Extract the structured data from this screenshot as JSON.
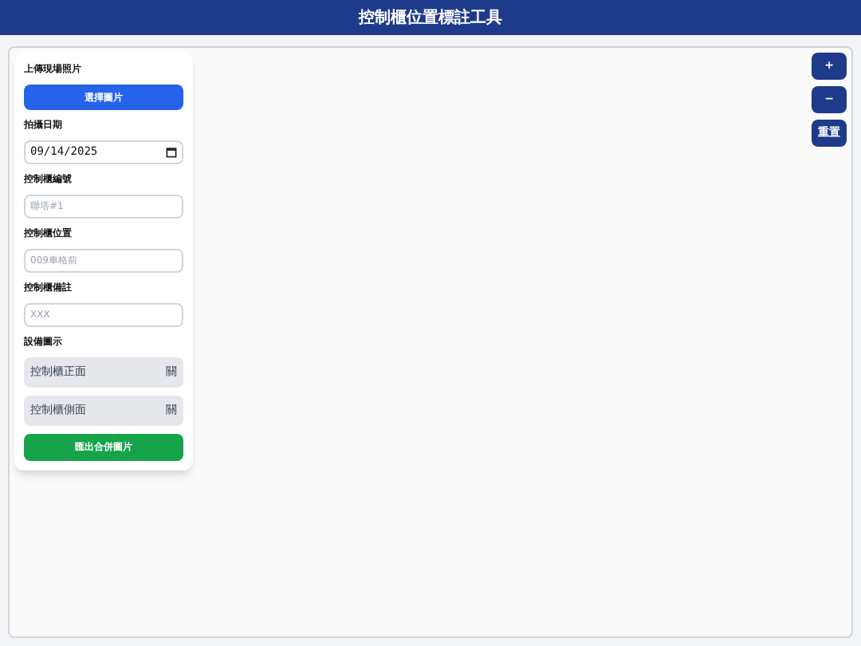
{
  "header": {
    "title": "控制櫃位置標註工具"
  },
  "panel": {
    "upload_label": "上傳現場照片",
    "upload_button": "選擇圖片",
    "date_label": "拍攝日期",
    "date_value": "09/14/2025",
    "fields": [
      {
        "label": "控制櫃編號",
        "placeholder": "聯塔#1"
      },
      {
        "label": "控制櫃位置",
        "placeholder": "009車格前"
      },
      {
        "label": "控制櫃備註",
        "placeholder": "XXX"
      }
    ],
    "icons_label": "設備圖示",
    "toggles": [
      {
        "label": "控制櫃正面",
        "state": "關",
        "on": false
      },
      {
        "label": "控制櫃側面",
        "state": "關",
        "on": false
      }
    ],
    "export_button": "匯出合併圖片"
  },
  "canvas_controls": [
    "+",
    "−",
    "重置"
  ]
}
